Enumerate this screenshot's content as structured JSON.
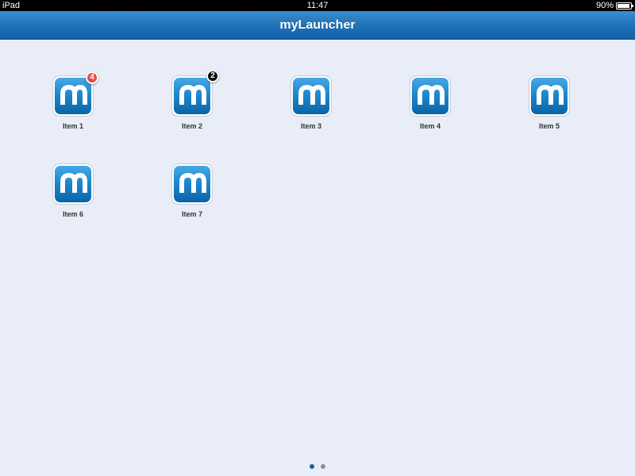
{
  "status_bar": {
    "device": "iPad",
    "time": "11:47",
    "battery": "90%",
    "battery_level": 0.9
  },
  "nav_bar": {
    "title": "myLauncher"
  },
  "colors": {
    "nav_bar": "#1f72b8",
    "background": "#e9edf7",
    "badge_red": "#e34b4b",
    "badge_black": "#111111",
    "active_page_dot": "#1f5fa0"
  },
  "launcher": {
    "icon_name": "app-logo-icon",
    "items": [
      {
        "label": "Item 1",
        "badge": "4",
        "badge_style": "red"
      },
      {
        "label": "Item 2",
        "badge": "2",
        "badge_style": "black"
      },
      {
        "label": "Item 3"
      },
      {
        "label": "Item 4"
      },
      {
        "label": "Item 5"
      },
      {
        "label": "Item 6"
      },
      {
        "label": "Item 7"
      }
    ]
  },
  "page_control": {
    "pages": 2,
    "current": 1
  }
}
